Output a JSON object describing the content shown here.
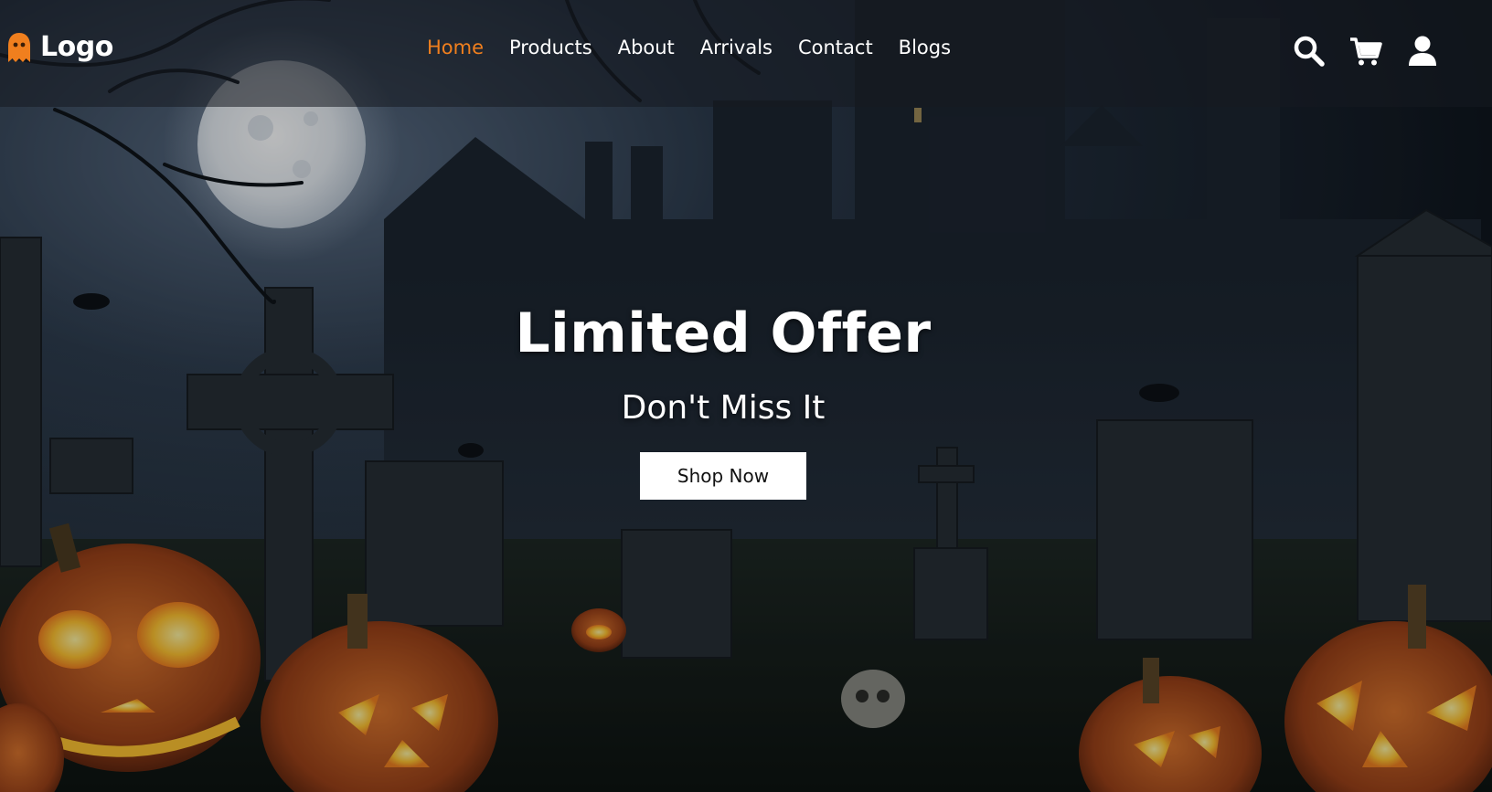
{
  "colors": {
    "accent": "#f07f1e",
    "header_bg": "rgba(22,26,32,0.55)",
    "button_bg": "#ffffff",
    "button_text": "#111111"
  },
  "header": {
    "logo_icon": "ghost-icon",
    "logo_text": "Logo",
    "nav": [
      {
        "label": "Home",
        "active": true
      },
      {
        "label": "Products",
        "active": false
      },
      {
        "label": "About",
        "active": false
      },
      {
        "label": "Arrivals",
        "active": false
      },
      {
        "label": "Contact",
        "active": false
      },
      {
        "label": "Blogs",
        "active": false
      }
    ],
    "icons": [
      "search-icon",
      "cart-icon",
      "user-icon"
    ]
  },
  "hero": {
    "title": "Limited Offer",
    "subtitle": "Don't Miss It",
    "button_label": "Shop Now",
    "background": "halloween-graveyard-image"
  }
}
